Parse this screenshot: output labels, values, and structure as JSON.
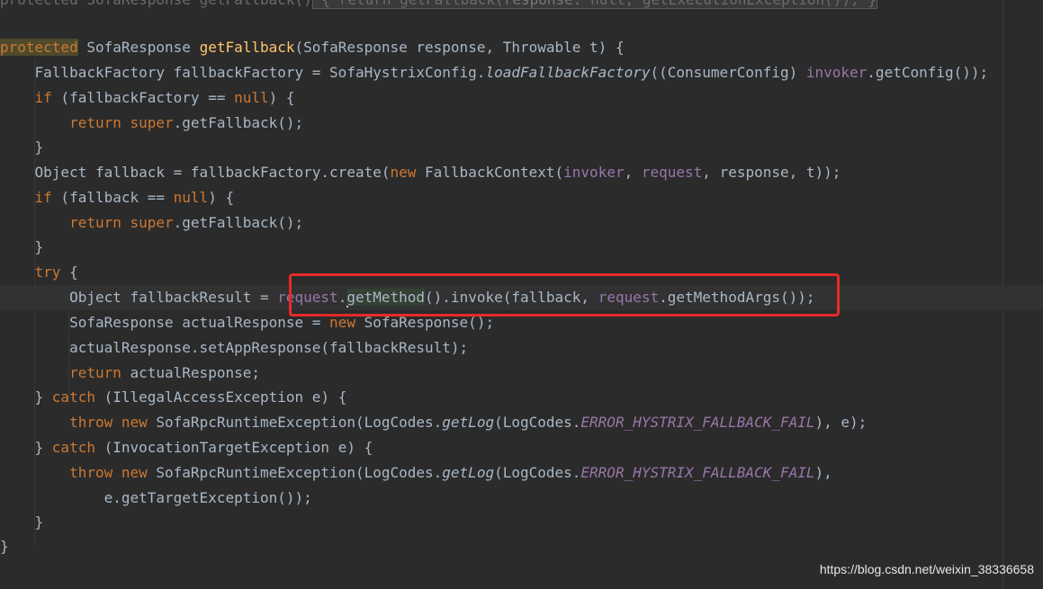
{
  "code": {
    "line_1": {
      "kw": "protected ",
      "ret": "SofaResponse ",
      "name": "getFallback",
      "paren_open": "()",
      "brace_open": " { ",
      "ret_kw": "return ",
      "call": "getFallback(",
      "param_hint": "response: ",
      "hint_null": "null",
      "sep": ", ",
      "call2": "getExecutionException()",
      "tail": "); ",
      "brace_close": "}"
    },
    "line_3": {
      "kw": "protected",
      "sig_a": " SofaResponse ",
      "name": "getFallback",
      "sig_b": "(SofaResponse response, Throwable t) {"
    },
    "line_4": {
      "a": "    FallbackFactory fallbackFactory = SofaHystrixConfig.",
      "sm": "loadFallbackFactory",
      "b": "((ConsumerConfig) ",
      "fld": "invoker",
      "c": ".getConfig());"
    },
    "line_5": {
      "kw": "    if",
      "a": " (fallbackFactory == ",
      "kw2": "null",
      "b": ") {"
    },
    "line_6": {
      "kw": "        return super",
      "a": ".getFallback();"
    },
    "line_7": {
      "a": "    }"
    },
    "line_8": {
      "a": "    Object fallback = fallbackFactory.create(",
      "kw": "new",
      "b": " FallbackContext(",
      "fld1": "invoker",
      "c": ", ",
      "fld2": "request",
      "d": ", response, t));"
    },
    "line_9": {
      "kw": "    if",
      "a": " (fallback == ",
      "kw2": "null",
      "b": ") {"
    },
    "line_10": {
      "kw": "        return super",
      "a": ".getFallback();"
    },
    "line_11": {
      "a": "    }"
    },
    "line_12": {
      "kw": "    try",
      "a": " {"
    },
    "line_13": {
      "a": "        Object fallbackResult = ",
      "fld": "request",
      "b": ".",
      "sym": "getMethod",
      "c": "().invoke(fallback, ",
      "fld2": "request",
      "d": ".getMethodArgs());"
    },
    "line_14": {
      "a": "        SofaResponse actualResponse = ",
      "kw": "new",
      "b": " SofaResponse();"
    },
    "line_15": {
      "a": "        actualResponse.setAppResponse(fallbackResult);"
    },
    "line_16": {
      "kw": "        return",
      "a": " actualResponse;"
    },
    "line_17": {
      "a": "    } ",
      "kw": "catch",
      "b": " (IllegalAccessException e) {"
    },
    "line_18": {
      "kw": "        throw new",
      "a": " SofaRpcRuntimeException(LogCodes.",
      "sm": "getLog",
      "b": "(LogCodes.",
      "sf": "ERROR_HYSTRIX_FALLBACK_FAIL",
      "c": "), e);"
    },
    "line_19": {
      "a": "    } ",
      "kw": "catch",
      "b": " (InvocationTargetException e) {"
    },
    "line_20": {
      "kw": "        throw new",
      "a": " SofaRpcRuntimeException(LogCodes.",
      "sm": "getLog",
      "b": "(LogCodes.",
      "sf": "ERROR_HYSTRIX_FALLBACK_FAIL",
      "c": "),"
    },
    "line_21": {
      "a": "            e.getTargetException());"
    },
    "line_22": {
      "a": "    }"
    },
    "line_23": {
      "a": "}"
    }
  },
  "watermark": "https://blog.csdn.net/weixin_38336658",
  "colors": {
    "background": "#2b2b2b",
    "keyword": "#cc7832",
    "method_decl": "#ffc66d",
    "field": "#9876aa",
    "plain": "#a9b7c6",
    "annotation_box": "#e82a2a"
  }
}
